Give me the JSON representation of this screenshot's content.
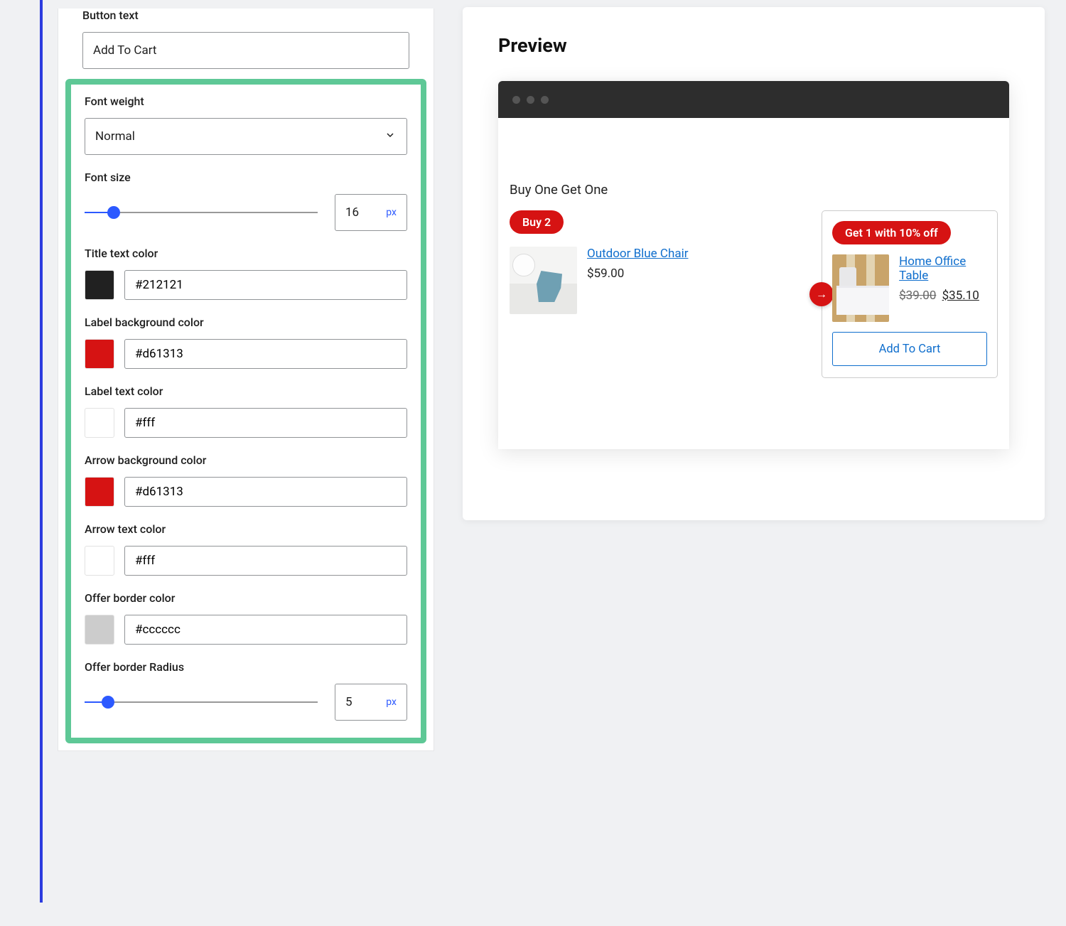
{
  "settings": {
    "button_text": {
      "label": "Button text",
      "value": "Add To Cart"
    },
    "font_weight": {
      "label": "Font weight",
      "value": "Normal"
    },
    "font_size": {
      "label": "Font size",
      "value": "16",
      "unit": "px",
      "min": 8,
      "max": 72
    },
    "title_color": {
      "label": "Title text color",
      "value": "#212121"
    },
    "label_bg": {
      "label": "Label background color",
      "value": "#d61313"
    },
    "label_text": {
      "label": "Label text color",
      "value": "#fff"
    },
    "arrow_bg": {
      "label": "Arrow background color",
      "value": "#d61313"
    },
    "arrow_text": {
      "label": "Arrow text color",
      "value": "#fff"
    },
    "offer_border": {
      "label": "Offer border color",
      "value": "#cccccc"
    },
    "offer_radius": {
      "label": "Offer border Radius",
      "value": "5",
      "unit": "px",
      "min": 0,
      "max": 50
    }
  },
  "preview": {
    "heading": "Preview",
    "bogo_title": "Buy One Get One",
    "buy": {
      "badge": "Buy 2",
      "product_name": "Outdoor Blue Chair",
      "price": "$59.00"
    },
    "get": {
      "badge": "Get 1 with 10% off",
      "product_name": "Home Office Table",
      "original_price": "$39.00",
      "sale_price": "$35.10",
      "button": "Add To Cart"
    },
    "arrow_glyph": "→"
  }
}
